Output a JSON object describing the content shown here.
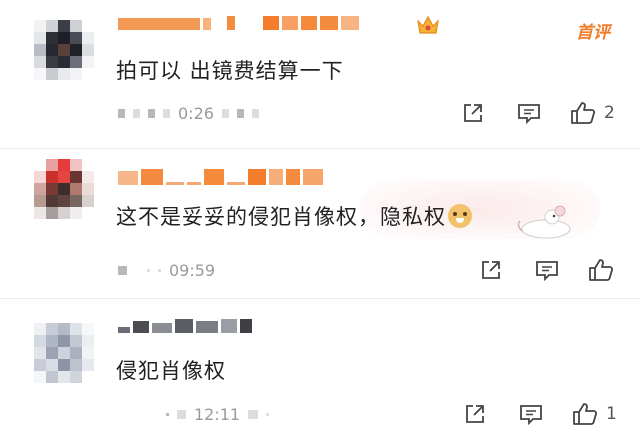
{
  "comments": [
    {
      "text": "拍可以 出镜费结算一下",
      "time": "0:26",
      "like_count": "2",
      "badge": "首评"
    },
    {
      "text": "这不是妥妥的侵犯肖像权，隐私权",
      "time": "09:59",
      "like_count": ""
    },
    {
      "text": "侵犯肖像权",
      "time": "12:11",
      "like_count": "1"
    }
  ],
  "icons": {
    "share": "share-icon",
    "reply": "comment-icon",
    "like": "thumbs-up-icon",
    "crown": "crown-icon",
    "emoji": "doge-emoji",
    "sticker": "mouse-sticker"
  },
  "colors": {
    "accent": "#f07c2a",
    "meta": "#9a9a9a",
    "icon": "#444444"
  }
}
